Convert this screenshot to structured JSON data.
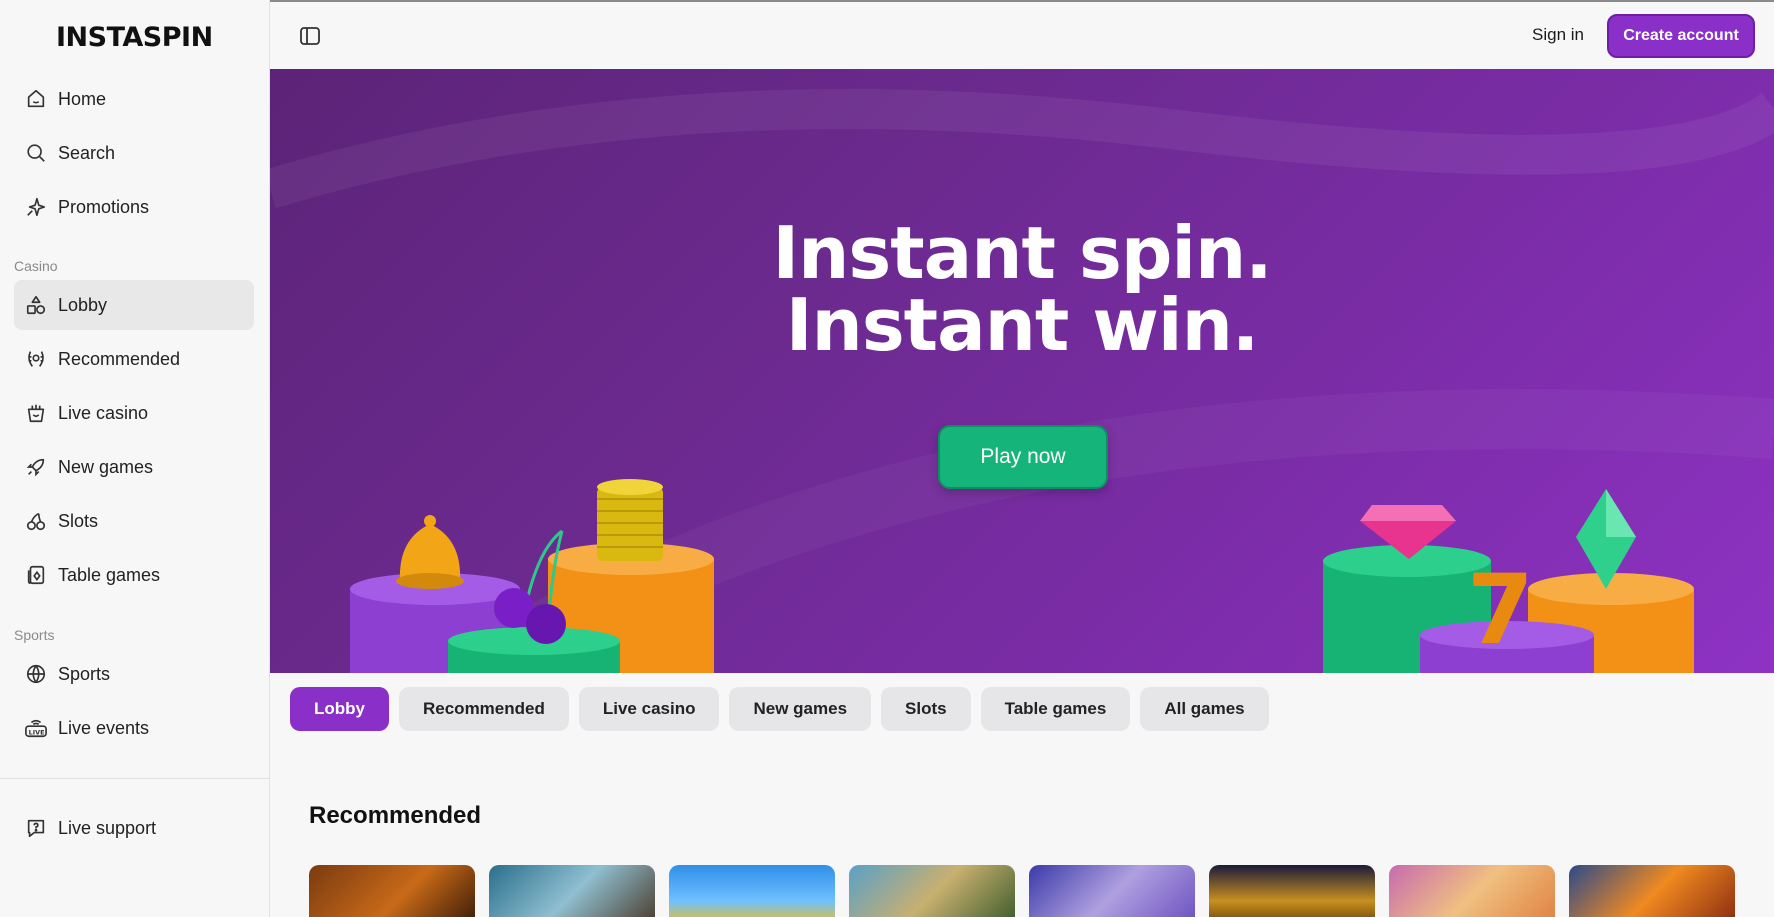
{
  "logo": "INSTASPIN",
  "sidebar": {
    "top_items": [
      {
        "label": "Home",
        "icon": "home-icon"
      },
      {
        "label": "Search",
        "icon": "search-icon"
      },
      {
        "label": "Promotions",
        "icon": "sparkle-icon"
      }
    ],
    "casino_label": "Casino",
    "casino_items": [
      {
        "label": "Lobby",
        "icon": "shapes-icon",
        "active": true
      },
      {
        "label": "Recommended",
        "icon": "laurel-icon"
      },
      {
        "label": "Live casino",
        "icon": "gift-icon"
      },
      {
        "label": "New games",
        "icon": "rocket-icon"
      },
      {
        "label": "Slots",
        "icon": "cherry-icon"
      },
      {
        "label": "Table games",
        "icon": "cards-icon"
      }
    ],
    "sports_label": "Sports",
    "sports_items": [
      {
        "label": "Sports",
        "icon": "ball-icon"
      },
      {
        "label": "Live events",
        "icon": "live-icon"
      }
    ],
    "support": {
      "label": "Live support",
      "icon": "help-icon"
    }
  },
  "header": {
    "signin": "Sign in",
    "create": "Create account"
  },
  "hero": {
    "line1": "Instant spin.",
    "line2": "Instant win.",
    "cta": "Play now"
  },
  "tabs": [
    "Lobby",
    "Recommended",
    "Live casino",
    "New games",
    "Slots",
    "Table games",
    "All games"
  ],
  "recommended_title": "Recommended",
  "colors": {
    "accent": "#8b2fc9",
    "cta_green": "#15b47a"
  }
}
